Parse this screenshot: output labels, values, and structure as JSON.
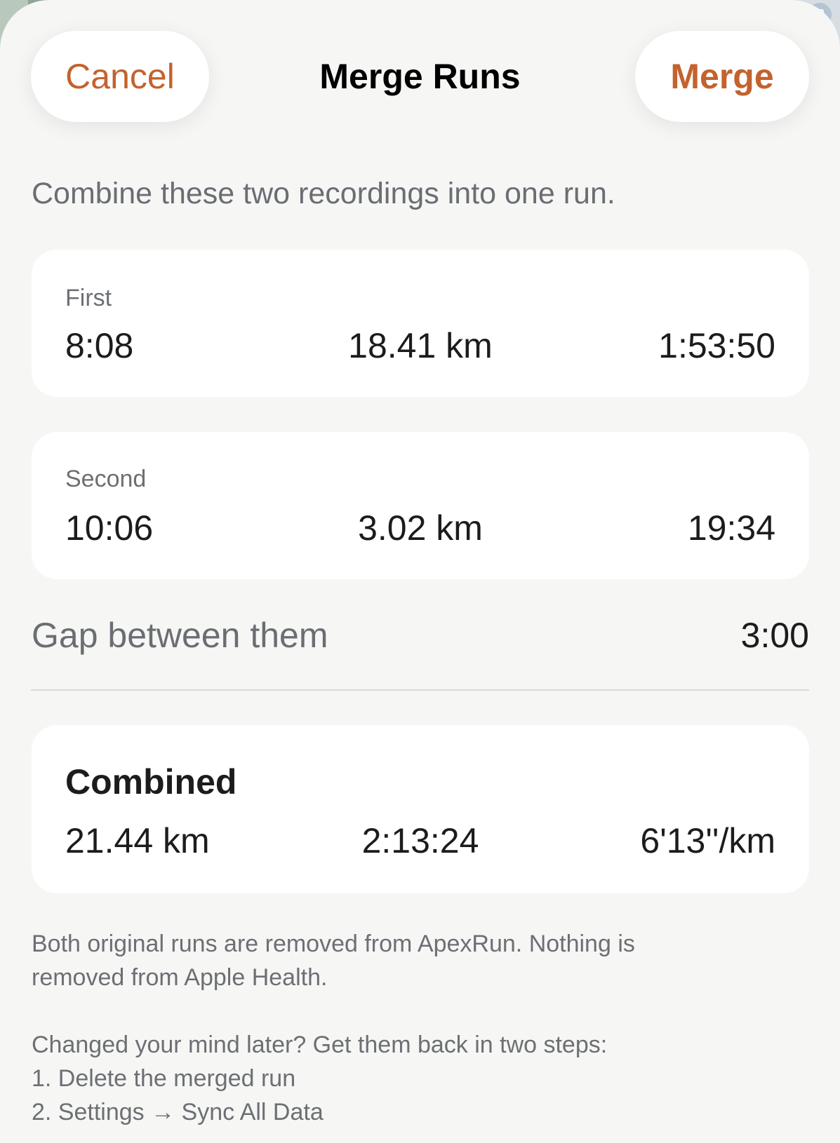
{
  "header": {
    "cancel_label": "Cancel",
    "title": "Merge Runs",
    "merge_label": "Merge"
  },
  "intro": "Combine these two recordings into one run.",
  "first_run": {
    "label": "First",
    "pace": "8:08",
    "distance": "18.41 km",
    "duration": "1:53:50"
  },
  "second_run": {
    "label": "Second",
    "pace": "10:06",
    "distance": "3.02 km",
    "duration": "19:34"
  },
  "gap": {
    "label": "Gap between them",
    "value": "3:00"
  },
  "combined": {
    "title": "Combined",
    "distance": "21.44 km",
    "duration": "2:13:24",
    "pace": "6'13''/km"
  },
  "notes": {
    "removal_line1": "Both original runs are removed from ApexRun. Nothing is",
    "removal_line2": "removed from Apple Health.",
    "restore_intro": "Changed your mind later? Get them back in two steps:",
    "step1": "1. Delete the merged run",
    "step2": "2. Settings → Sync All Data"
  },
  "colors": {
    "accent": "#c4622e",
    "sheet_background": "#f6f6f5",
    "card_background": "#ffffff",
    "secondary_text": "#6a6e73"
  },
  "icons": {
    "map_corner": "train-icon"
  }
}
